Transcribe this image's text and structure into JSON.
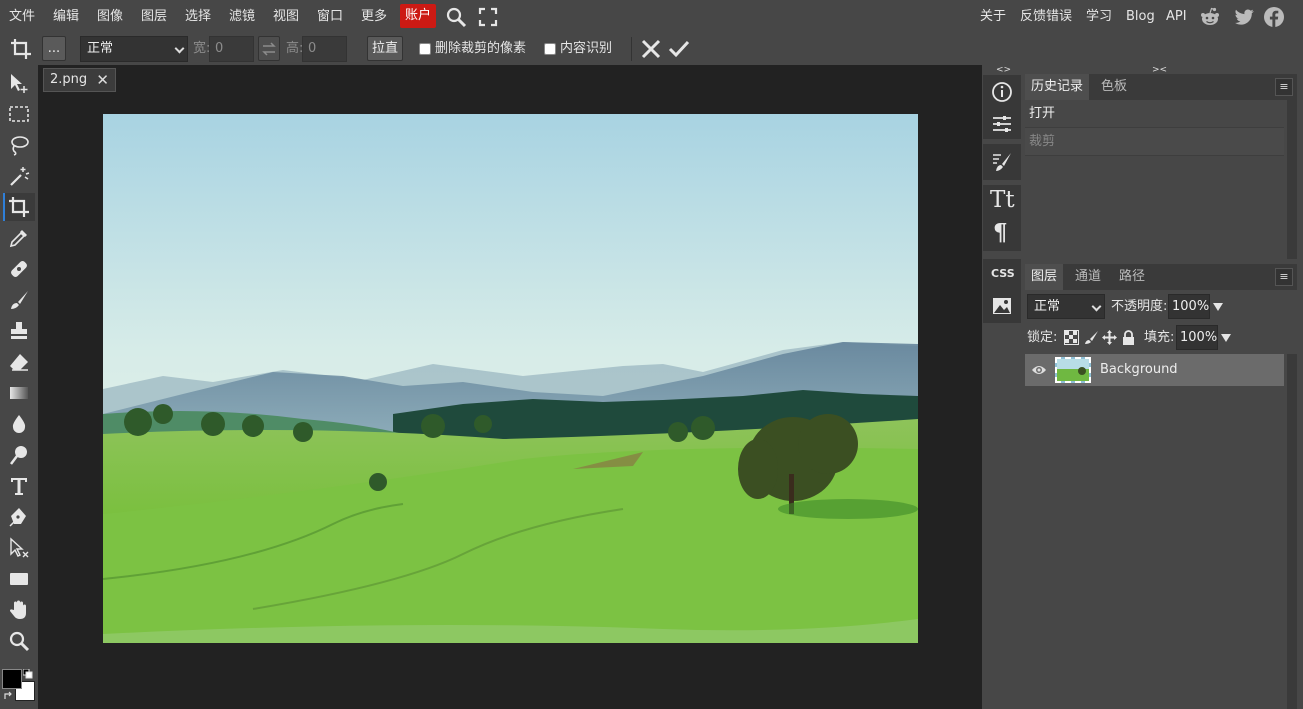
{
  "menu": {
    "items": [
      "文件",
      "编辑",
      "图像",
      "图层",
      "选择",
      "滤镜",
      "视图",
      "窗口",
      "更多"
    ],
    "account": "账户",
    "right_links": [
      "关于",
      "反馈错误",
      "学习",
      "Blog",
      "API"
    ]
  },
  "options": {
    "more_label": "...",
    "mode_value": "正常",
    "width_label": "宽:",
    "width_value": "0",
    "height_label": "高:",
    "height_value": "0",
    "straighten_label": "拉直",
    "delete_cropped_label": "删除裁剪的像素",
    "content_aware_label": "内容识别"
  },
  "document": {
    "tab_name": "2.png",
    "close_symbol": "✕"
  },
  "side_strip": {
    "css_label": "CSS",
    "text_tool_label": "Tt",
    "paragraph_label": "¶"
  },
  "history_panel": {
    "tabs": [
      "历史记录",
      "色板"
    ],
    "menu_symbol": "≡",
    "entries": [
      "打开",
      "裁剪"
    ]
  },
  "layers_panel": {
    "tabs": [
      "图层",
      "通道",
      "路径"
    ],
    "menu_symbol": "≡",
    "blend_mode": "正常",
    "opacity_label": "不透明度:",
    "opacity_value": "100%",
    "lock_label": "锁定:",
    "fill_label": "填充:",
    "fill_value": "100%",
    "layers": [
      {
        "name": "Background",
        "visible": true
      }
    ]
  },
  "colors": {
    "accent": "#2f7fd8",
    "account_bg": "#cc1a14",
    "foreground": "#000000",
    "background": "#ffffff"
  }
}
